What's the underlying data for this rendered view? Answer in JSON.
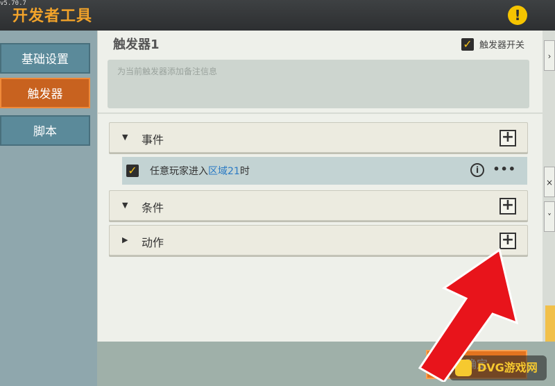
{
  "version": "v5.70.7",
  "app": {
    "title": "开发者工具"
  },
  "sidebar": {
    "items": [
      {
        "label": "基础设置",
        "active": false
      },
      {
        "label": "触发器",
        "active": true
      },
      {
        "label": "脚本",
        "active": false
      }
    ]
  },
  "trigger": {
    "name": "触发器1",
    "toggle_label": "触发器开关",
    "toggle_checked": true,
    "note_placeholder": "为当前触发器添加备注信息"
  },
  "sections": {
    "event": {
      "label": "事件",
      "expanded": true
    },
    "condition": {
      "label": "条件",
      "expanded": true
    },
    "action": {
      "label": "动作",
      "expanded": false
    }
  },
  "event_item": {
    "checked": true,
    "text_prefix": "任意玩家进入",
    "text_highlight": "区域21",
    "text_suffix": "时"
  },
  "footer": {
    "confirm_label": "确定"
  },
  "watermark": "DVG游戏网",
  "colors": {
    "accent": "#f2a32a",
    "active_tab": "#c8621f",
    "highlight": "#2a7ac4",
    "arrow": "#e8141b"
  }
}
